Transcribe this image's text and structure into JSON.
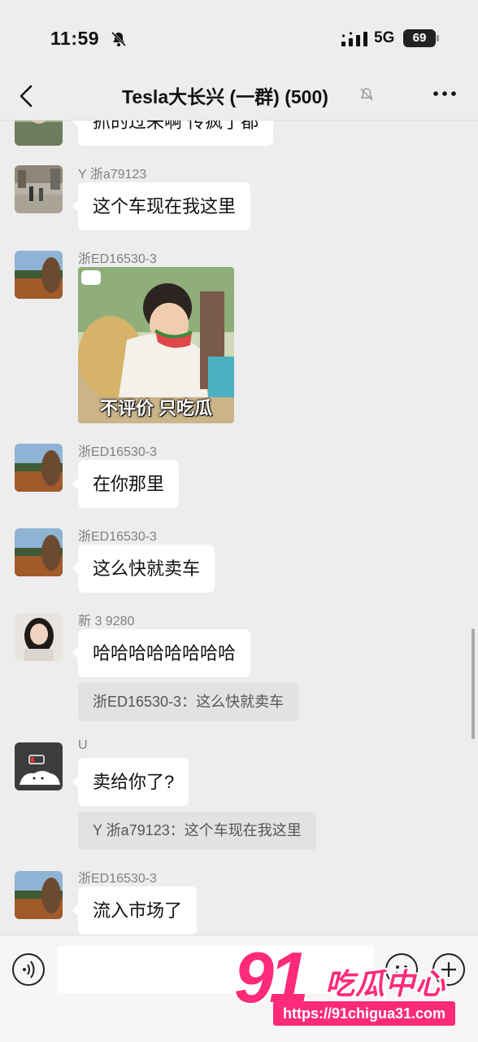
{
  "status": {
    "time": "11:59",
    "network": "5G",
    "battery": "69"
  },
  "nav": {
    "title": "Tesla大长兴 (一群) (500)"
  },
  "messages": [
    {
      "text": "抓的过来啊 传疯了都"
    },
    {
      "nick": "Y 浙a79123",
      "text": "这个车现在我这里"
    },
    {
      "nick": "浙ED16530-3",
      "sticker_caption": "不评价 只吃瓜"
    },
    {
      "nick": "浙ED16530-3",
      "text": "在你那里"
    },
    {
      "nick": "浙ED16530-3",
      "text": "这么快就卖车"
    },
    {
      "nick": "新 3 9280",
      "text": "哈哈哈哈哈哈哈哈",
      "quote": "浙ED16530-3：这么快就卖车"
    },
    {
      "nick": "U",
      "text": "卖给你了?",
      "quote": "Y 浙a79123：这个车现在我这里"
    },
    {
      "nick": "浙ED16530-3",
      "text": "流入市场了"
    }
  ],
  "watermark": {
    "number": "91",
    "name": "吃瓜中心",
    "url": "https://91chigua31.com"
  },
  "colors": {
    "background": "#ededed",
    "bubble": "#ffffff",
    "quote": "#e2e2e2",
    "watermark": "#ff2a7a"
  }
}
